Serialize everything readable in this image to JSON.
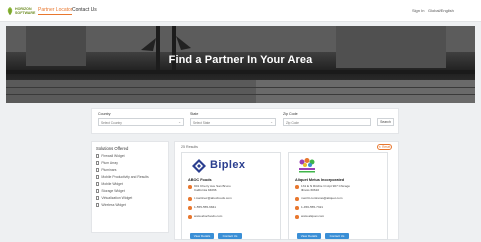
{
  "header": {
    "logo_text": "HORIZON SOFTWARE",
    "nav": [
      "Partner Locator",
      "Contact Us"
    ],
    "sign_in": "Sign In",
    "language": "Global/English"
  },
  "hero": {
    "title": "Find a Partner In Your Area"
  },
  "search": {
    "country_label": "Country",
    "country_value": "Select Country",
    "state_label": "State",
    "state_value": "Select State",
    "zip_label": "Zip Code",
    "zip_placeholder": "Zip Code",
    "search_button": "Search"
  },
  "filters": {
    "title": "Solutions Offered",
    "items": [
      "Firewall Widget",
      "Plum Array",
      "Pluminars",
      "Mobile Productivity and Results",
      "Mobile Widget",
      "Storage Widget",
      "Virtualization Widget",
      "Wireless Widget"
    ]
  },
  "results": {
    "count_text": "25 Results",
    "reset_label": "Reset",
    "cards": [
      {
        "logo_text": "Biplex",
        "name": "ABOC Foods",
        "address": "901 Cherry Ave San Bruno California 94066",
        "email": "t.martinez@abocfoods.com",
        "phone": "1-555-555-6841",
        "website": "www.abocfoods.com",
        "view_details": "View Details",
        "contact": "Contact Us"
      },
      {
        "logo_text": "Aliquet Metus",
        "name": "Aliquet Metus Incorporated",
        "address": "131 E N Ritchie Ct Apt 907 Chicago Illinois 60610",
        "email": "merritt.contreras@aliquet.com",
        "phone": "1-456-555-7321",
        "website": "www.aliquet.com",
        "view_details": "View Details",
        "contact": "Contact Us"
      }
    ]
  },
  "colors": {
    "accent": "#e8772e",
    "button": "#3a8fd6",
    "brand_green": "#6a8a1f",
    "biplex_blue": "#2a3e8f"
  }
}
